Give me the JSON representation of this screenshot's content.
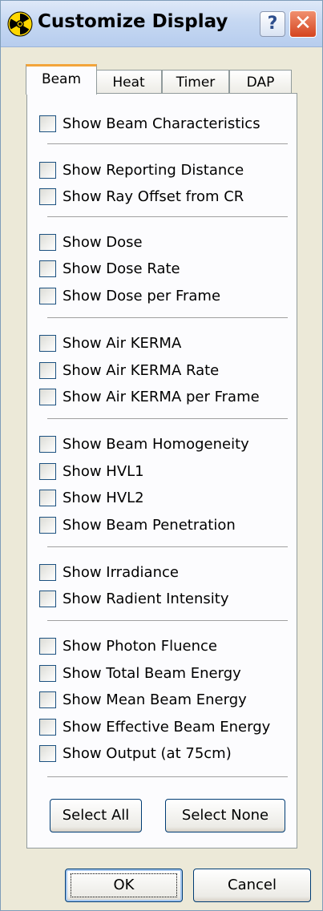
{
  "window": {
    "title": "Customize Display",
    "icon": "radiation-icon",
    "help_label": "?",
    "close_label": "✕"
  },
  "tabs": [
    "Beam",
    "Heat",
    "Timer",
    "DAP"
  ],
  "active_tab": "Beam",
  "checkbox_groups": [
    [
      "Show Beam Characteristics"
    ],
    [
      "Show Reporting Distance",
      "Show Ray Offset from CR"
    ],
    [
      "Show Dose",
      "Show Dose Rate",
      "Show Dose per Frame"
    ],
    [
      "Show Air KERMA",
      "Show Air KERMA Rate",
      "Show Air KERMA per Frame"
    ],
    [
      "Show Beam Homogeneity",
      "Show HVL1",
      "Show HVL2",
      "Show Beam Penetration"
    ],
    [
      "Show Irradiance",
      "Show Radient Intensity"
    ],
    [
      "Show Photon Fluence",
      "Show Total Beam Energy",
      "Show Mean Beam Energy",
      "Show Effective Beam Energy",
      "Show Output (at 75cm)"
    ]
  ],
  "buttons": {
    "select_all": "Select All",
    "select_none": "Select None",
    "ok": "OK",
    "cancel": "Cancel"
  },
  "colors": {
    "accent_tab": "#f3a53a",
    "close_button": "#d4441f",
    "radiation_yellow": "#ffd700"
  }
}
